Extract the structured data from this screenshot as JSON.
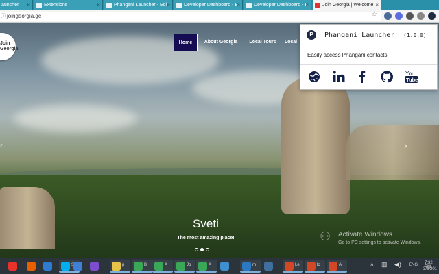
{
  "browser": {
    "tabs": [
      {
        "label": "auncher",
        "active": false
      },
      {
        "label": "Extensions",
        "active": false
      },
      {
        "label": "Phangani Launcher - Edi",
        "active": false
      },
      {
        "label": "Developer Dashboard - E",
        "active": false
      },
      {
        "label": "Developer Dashboard - E",
        "active": false
      },
      {
        "label": "Join Georgia | Welcome",
        "active": true
      }
    ],
    "url": "joingeorgia.ge",
    "extension_colors": [
      "#4a6a9a",
      "#5b6ee1",
      "#555555",
      "#888888",
      "#1f2a44"
    ]
  },
  "site": {
    "logo_text": "Join Georgia",
    "nav": [
      {
        "label": "Home",
        "active": true
      },
      {
        "label": "About Georgia",
        "active": false
      },
      {
        "label": "Local Tours",
        "active": false
      },
      {
        "label": "Local",
        "active": false
      }
    ],
    "slide": {
      "title": "Sveti",
      "subtitle": "The most amazing place!",
      "dots": 3,
      "active_dot": 2
    }
  },
  "popup": {
    "title": "Phangani Launcher",
    "version": "(1.0.0)",
    "description": "Easily access Phangani contacts",
    "icons": [
      "globe-icon",
      "linkedin-icon",
      "facebook-icon",
      "github-icon",
      "youtube-icon"
    ]
  },
  "watermark": {
    "title": "Activate Windows",
    "subtitle": "Go to PC settings to activate Windows."
  },
  "taskbar": {
    "items": [
      {
        "label": "",
        "color": "#e8322a"
      },
      {
        "label": "",
        "color": "#e66000"
      },
      {
        "label": "",
        "color": "#2f7bd0"
      },
      {
        "label": "Sk",
        "color": "#00aff0"
      },
      {
        "label": "",
        "color": "#3f7fd6"
      },
      {
        "label": "",
        "color": "#7d4dd0"
      },
      {
        "label": "p",
        "color": "#e8c34a"
      },
      {
        "label": "B",
        "color": "#3aa757"
      },
      {
        "label": "A",
        "color": "#3aa757"
      },
      {
        "label": "Jo",
        "color": "#3aa757"
      },
      {
        "label": "A",
        "color": "#3aa757"
      },
      {
        "label": "",
        "color": "#3d8fd0"
      },
      {
        "label": "m",
        "color": "#2b79c2"
      },
      {
        "label": "",
        "color": "#3e6f9e"
      },
      {
        "label": "Le",
        "color": "#d24726"
      },
      {
        "label": "lo",
        "color": "#d24726"
      },
      {
        "label": "A",
        "color": "#d24726"
      }
    ],
    "lang": "ENG",
    "time": "7:32 PM",
    "date": "3/8/201"
  }
}
